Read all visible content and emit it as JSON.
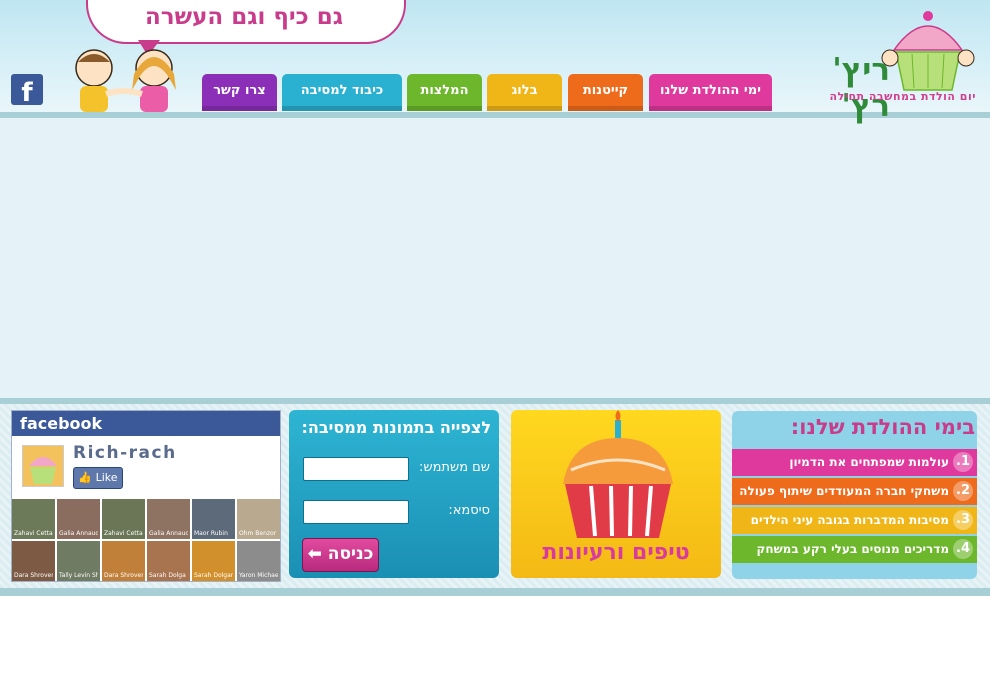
{
  "header": {
    "slogan": "גם כיף וגם העשרה",
    "logo_text": "ריץ' רץ'",
    "logo_sub": "יום הולדת במחשבה תחילה",
    "facebook_letter": "f"
  },
  "nav": [
    {
      "label": "ימי ההולדת שלנו",
      "color": "#e0399d"
    },
    {
      "label": "קייטנות",
      "color": "#ef6b1c"
    },
    {
      "label": "בלוג",
      "color": "#f0b617"
    },
    {
      "label": "המלצות",
      "color": "#6cb72b"
    },
    {
      "label": "כיבוד למסיבה",
      "color": "#2ab0d0"
    },
    {
      "label": "צרו קשר",
      "color": "#8b2fb8"
    }
  ],
  "fb": {
    "head": "facebook",
    "name": "Rich-rach",
    "like": "Like",
    "faces": [
      "Zahavi Cetta",
      "Galia Annaud",
      "Zahavi Cetta",
      "Galia Annaud",
      "Maor Rubin",
      "Ohm Benzor",
      "Dara Shrovers",
      "Tally Levin Shturm",
      "Dara Shrovers",
      "Sarah Dolga",
      "Sarah Dolgan",
      "Yaron Michaeli"
    ]
  },
  "login": {
    "title": "לצפייה בתמונות ממסיבה:",
    "user_label": "שם משתמש:",
    "pass_label": "סיסמא:",
    "button": "כניסה"
  },
  "tips": {
    "label": "טיפים ורעיונות"
  },
  "our_birthdays": {
    "title": "בימי ההולדת שלנו:",
    "items": [
      {
        "num": "1.",
        "text": "עולמות שמפתחים את הדמיון",
        "color": "#e0399d"
      },
      {
        "num": "2.",
        "text": "משחקי חברה המעודדים שיתוף פעולה",
        "color": "#ef6b1c"
      },
      {
        "num": "3.",
        "text": "מסיבות המדברות בגובה עיני הילדים",
        "color": "#f0b617"
      },
      {
        "num": "4.",
        "text": "מדריכים מנוסים בעלי רקע במשחק",
        "color": "#6cb72b"
      }
    ]
  }
}
